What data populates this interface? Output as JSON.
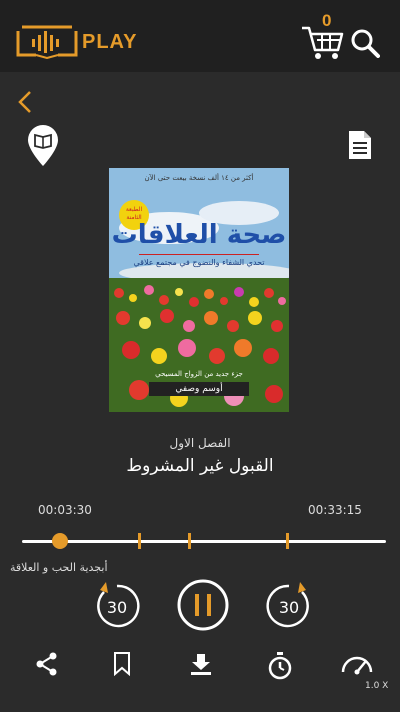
{
  "header": {
    "brand": "PLAY",
    "cart_count": "0",
    "accent": "#e59b2a"
  },
  "icons": {
    "back": "chevron-left-icon",
    "book_pin": "book-pin-icon",
    "document": "document-icon",
    "cart": "cart-icon",
    "search": "search-icon"
  },
  "cover": {
    "tagline": "أكثر من ١٤ ألف نسخة بيعت حتى الآن",
    "edition": "الطبعة الثامنة",
    "title": "صحة العلاقات",
    "subtitle": "تحدي الشفاء والنضوج في مجتمع علاقي",
    "note": "جزء جديد من الزواج المسيحي",
    "author": "أوسم وصفي"
  },
  "player": {
    "chapter_number": "الفصل الاول",
    "chapter_title": "القبول غير المشروط",
    "current_time": "00:03:30",
    "total_time": "00:33:15",
    "progress": 0.105,
    "book_title": "أبجدية الحب و العلاقة",
    "rewind_seconds": "30",
    "forward_seconds": "30"
  },
  "toolbar": {
    "speed": "1.0 X"
  }
}
